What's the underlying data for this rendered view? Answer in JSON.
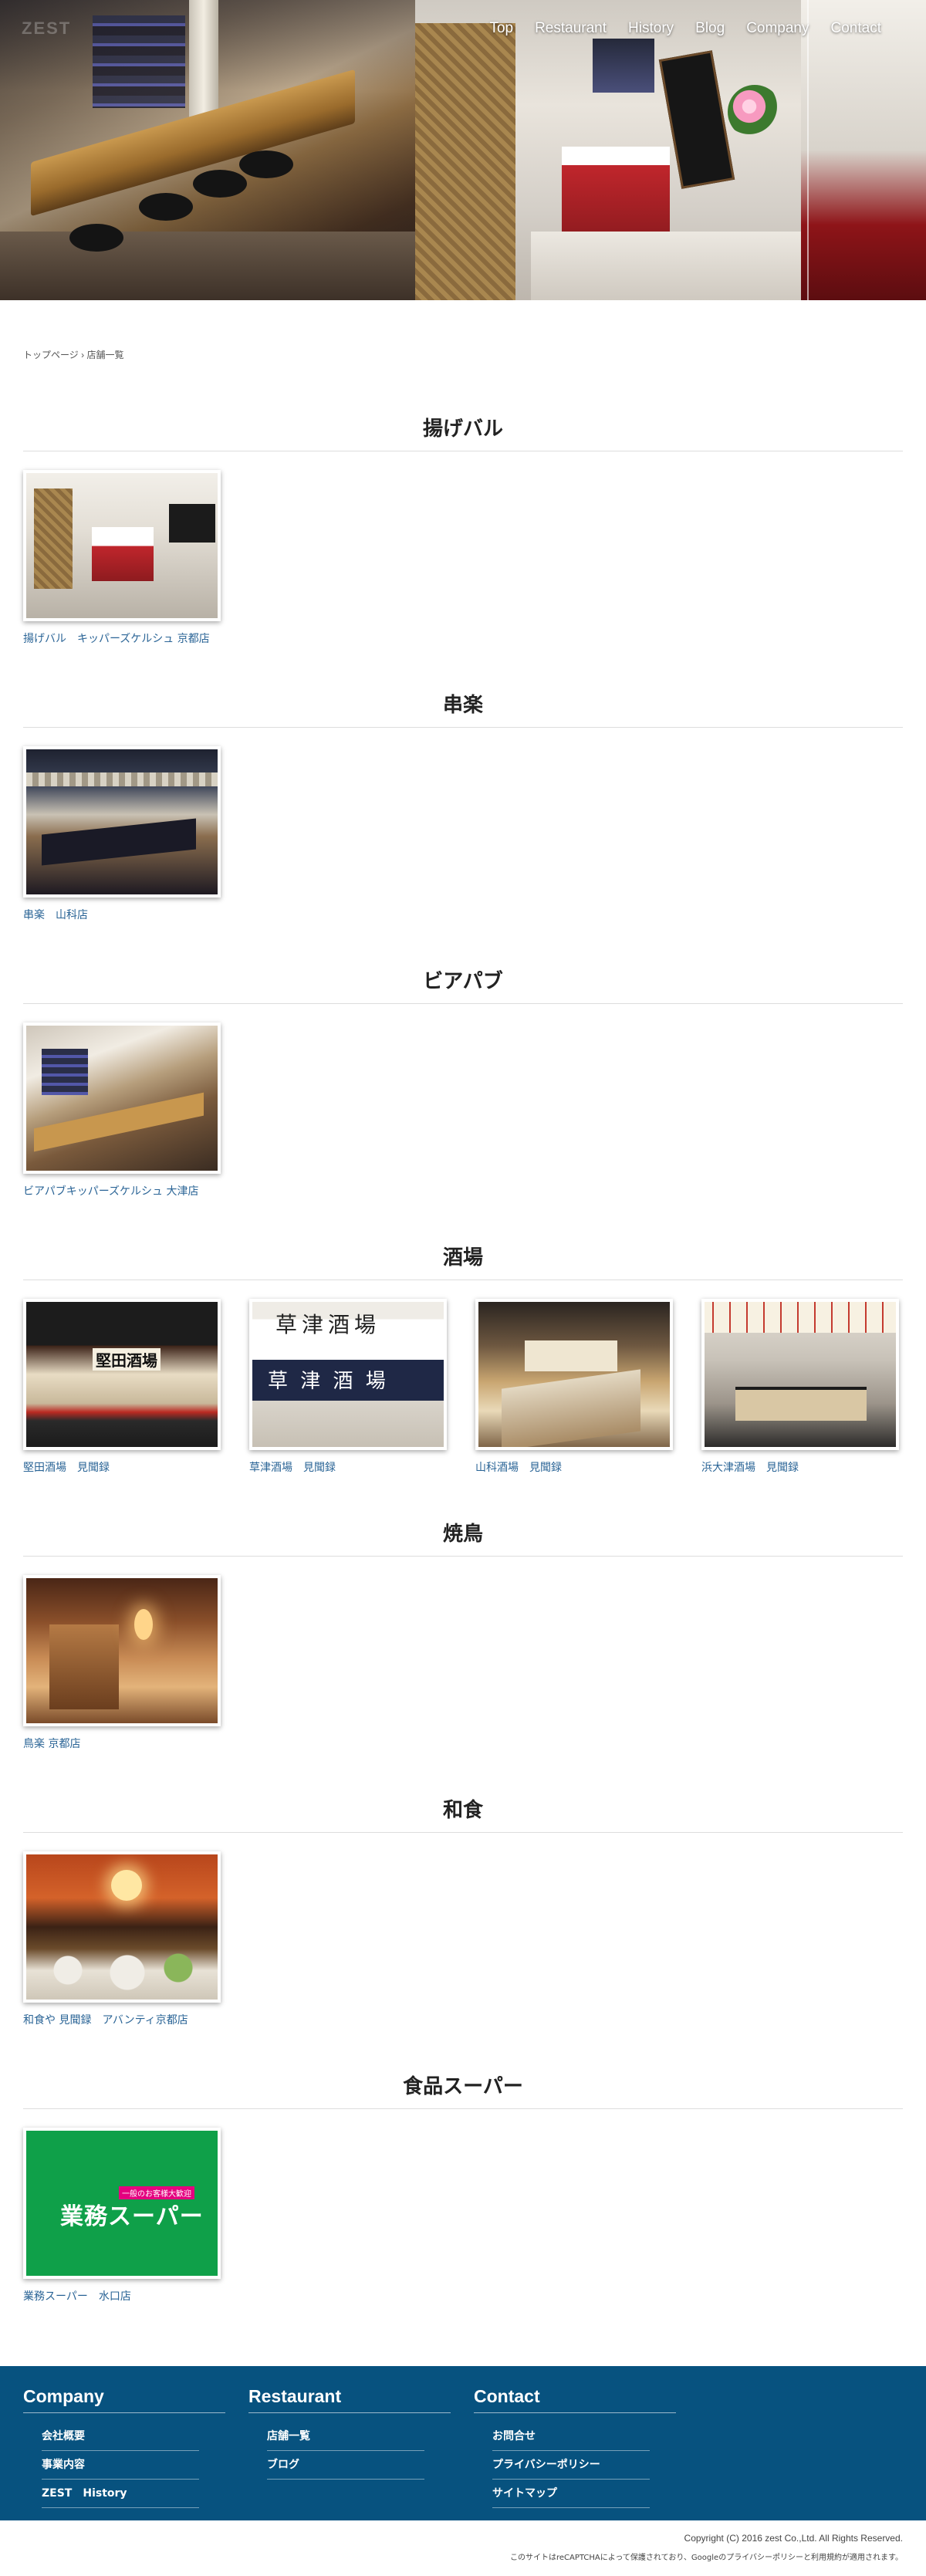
{
  "nav": {
    "items": [
      "Top",
      "Restaurant",
      "History",
      "Blog",
      "Company",
      "Contact"
    ]
  },
  "logo_text": "ZEST",
  "breadcrumb": {
    "home": "トップページ",
    "separator": "›",
    "current": "店舗一覧"
  },
  "sections": [
    {
      "title": "揚げバル",
      "stores": [
        {
          "label": "揚げバル　キッパーズケルシュ 京都店",
          "thumb": "th-agebar"
        }
      ]
    },
    {
      "title": "串楽",
      "stores": [
        {
          "label": "串楽　山科店",
          "thumb": "th-kushi"
        }
      ]
    },
    {
      "title": "ビアパブ",
      "stores": [
        {
          "label": "ビアパブキッパーズケルシュ 大津店",
          "thumb": "th-beer"
        }
      ]
    },
    {
      "title": "酒場",
      "stores": [
        {
          "label": "堅田酒場　見聞録",
          "thumb": "th-katata"
        },
        {
          "label": "草津酒場　見聞録",
          "thumb": "th-kusatsu"
        },
        {
          "label": "山科酒場　見聞録",
          "thumb": "th-yamashina"
        },
        {
          "label": "浜大津酒場　見聞録",
          "thumb": "th-hamaotsu"
        }
      ]
    },
    {
      "title": "焼鳥",
      "stores": [
        {
          "label": "鳥楽 京都店",
          "thumb": "th-yakitori"
        }
      ]
    },
    {
      "title": "和食",
      "stores": [
        {
          "label": "和食や 見聞録　アバンティ京都店",
          "thumb": "th-washoku"
        }
      ]
    },
    {
      "title": "食品スーパー",
      "stores": [
        {
          "label": "業務スーパー　水口店",
          "thumb": "th-gyomu"
        }
      ]
    }
  ],
  "gyomu_logo": {
    "badge": "一般のお客様大歓迎",
    "text": "業務スーパー"
  },
  "footer": {
    "company": {
      "title": "Company",
      "links": [
        "会社概要",
        "事業内容",
        "ZEST　History"
      ]
    },
    "restaurant": {
      "title": "Restaurant",
      "links": [
        "店舗一覧",
        "ブログ"
      ]
    },
    "contact": {
      "title": "Contact",
      "links": [
        "お問合せ",
        "プライバシーポリシー",
        "サイトマップ"
      ]
    }
  },
  "copyright": "Copyright (C) 2016 zest Co.,Ltd. All Rights Reserved.",
  "recaptcha_notice": "このサイトはreCAPTCHAによって保護されており、Googleのプライバシーポリシーと利用規約が適用されます。",
  "colors": {
    "footer_bg": "#07527f",
    "link": "#2a6496"
  }
}
